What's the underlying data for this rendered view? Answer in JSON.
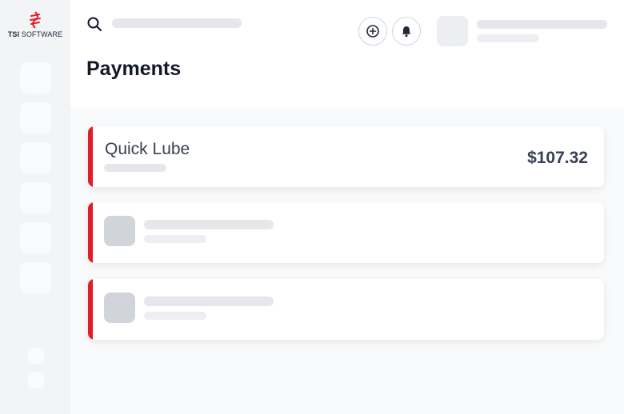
{
  "brand": {
    "name_bold": "TSI",
    "name_rest": " SOFTWARE",
    "logo_color": "#e11d2a"
  },
  "header": {
    "search_icon": "search-icon",
    "add_icon": "plus-circle-icon",
    "notification_icon": "bell-icon"
  },
  "page": {
    "title": "Payments"
  },
  "payments": [
    {
      "title": "Quick Lube",
      "amount": "$107.32"
    }
  ],
  "colors": {
    "accent": "#e11d2a",
    "skeleton": "#e5e7eb",
    "sidebar": "#f3f4f6"
  }
}
